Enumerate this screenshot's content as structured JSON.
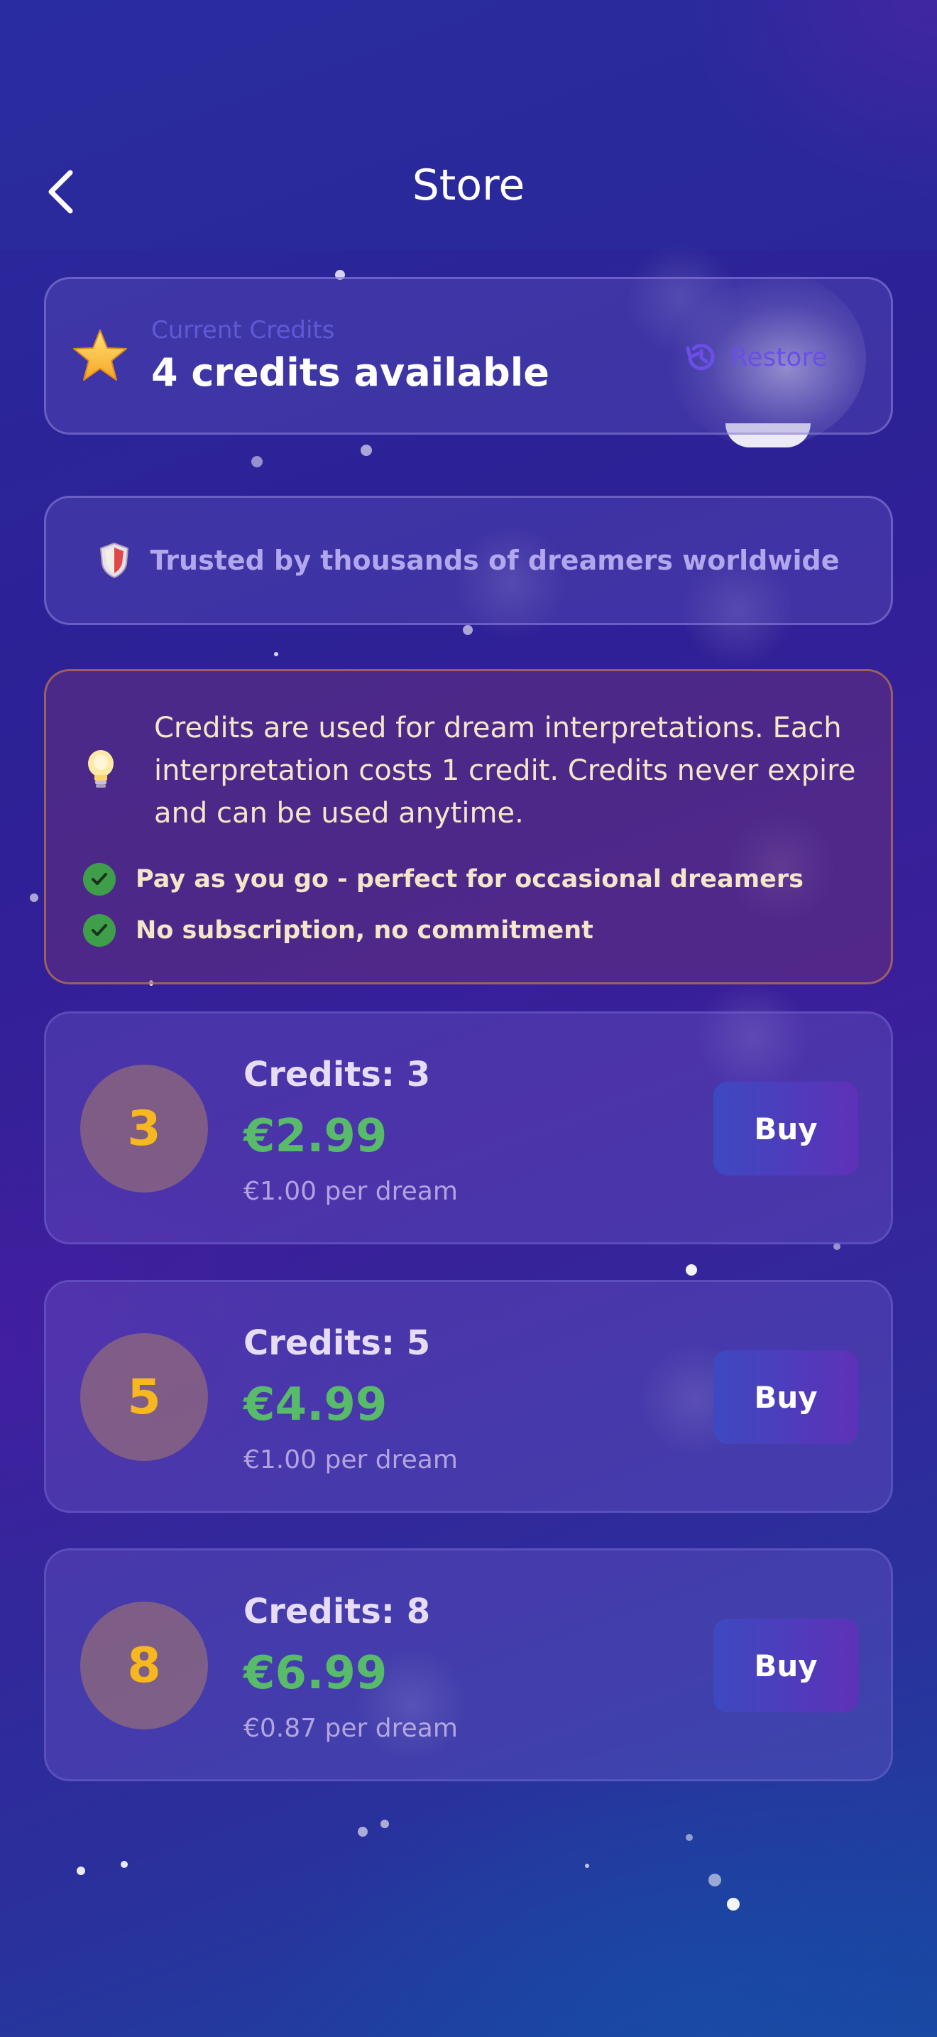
{
  "header": {
    "title": "Store",
    "back_icon": "chevron-left-icon"
  },
  "credits": {
    "label": "Current Credits",
    "value": "4 credits available",
    "icon": "star-icon",
    "restore_label": "Restore",
    "restore_icon": "history-icon"
  },
  "trust": {
    "text": "Trusted by thousands of dreamers worldwide",
    "icon": "shield-icon"
  },
  "info": {
    "text": "Credits are used for dream interpretations. Each interpretation costs 1 credit. Credits never expire and can be used anytime.",
    "icon": "lightbulb-icon",
    "points": [
      "Pay as you go - perfect for occasional dreamers",
      "No subscription, no commitment"
    ]
  },
  "packages": [
    {
      "badge": "3",
      "title": "Credits: 3",
      "price": "€2.99",
      "per": "€1.00 per dream",
      "buy_label": "Buy"
    },
    {
      "badge": "5",
      "title": "Credits: 5",
      "price": "€4.99",
      "per": "€1.00 per dream",
      "buy_label": "Buy"
    },
    {
      "badge": "8",
      "title": "Credits: 8",
      "price": "€6.99",
      "per": "€0.87 per dream",
      "buy_label": "Buy"
    }
  ],
  "colors": {
    "price": "#58bb6a",
    "badge_number": "#f7b81f",
    "restore": "#6a4fe6",
    "check": "#3f9e4a"
  }
}
